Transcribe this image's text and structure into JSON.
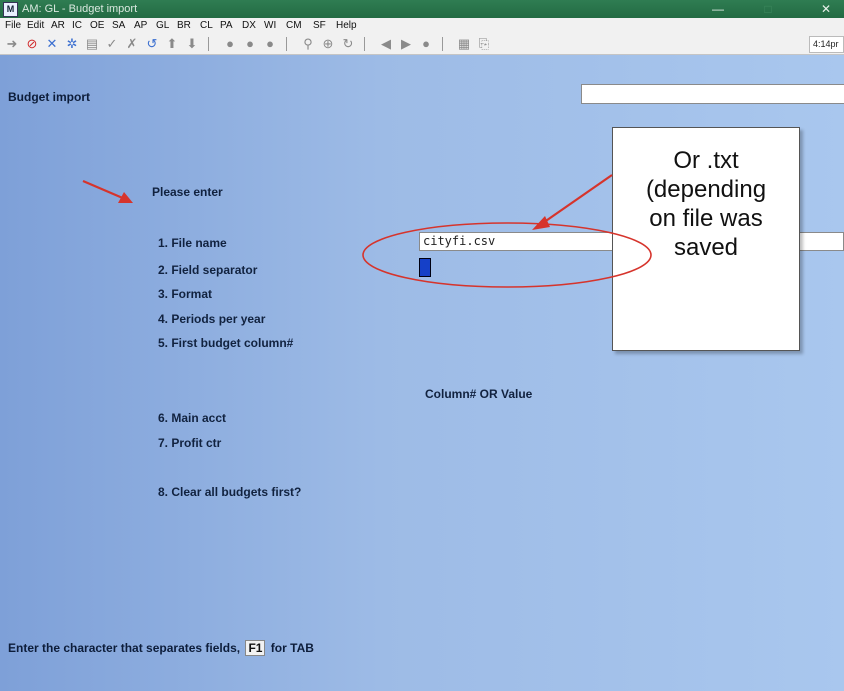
{
  "window": {
    "title": "AM: GL - Budget import",
    "app_icon": "M",
    "minimize": "—",
    "maximize": "□",
    "close": "✕"
  },
  "menu": [
    "File",
    "Edit",
    "AR",
    "IC",
    "OE",
    "SA",
    "AP",
    "GL",
    "BR",
    "CL",
    "PA",
    "DX",
    "WI",
    "CM",
    "SF",
    "Help"
  ],
  "toolbar": {
    "clock": "4:14pr"
  },
  "screen": {
    "title": "Budget import",
    "prompt": "Please enter",
    "fields": [
      {
        "label": "1. File name"
      },
      {
        "label": "2. Field separator"
      },
      {
        "label": "3. Format"
      },
      {
        "label": "4. Periods per year"
      },
      {
        "label": "5. First budget column#"
      }
    ],
    "column_header": "Column# OR Value",
    "fields2": [
      {
        "label": "6. Main acct"
      },
      {
        "label": "7. Profit ctr"
      }
    ],
    "clear_label": "8. Clear all budgets first?",
    "file_name_value": "cityfi.csv"
  },
  "callout": {
    "lines": [
      "Or .txt",
      "(depending",
      "on file was",
      "saved"
    ]
  },
  "status": {
    "before": "Enter the character that separates fields,",
    "key": "F1",
    "after": "for TAB"
  },
  "colors": {
    "arrow": "#e0302a",
    "background": "#8fb1e0",
    "cursor": "#1540c8"
  }
}
